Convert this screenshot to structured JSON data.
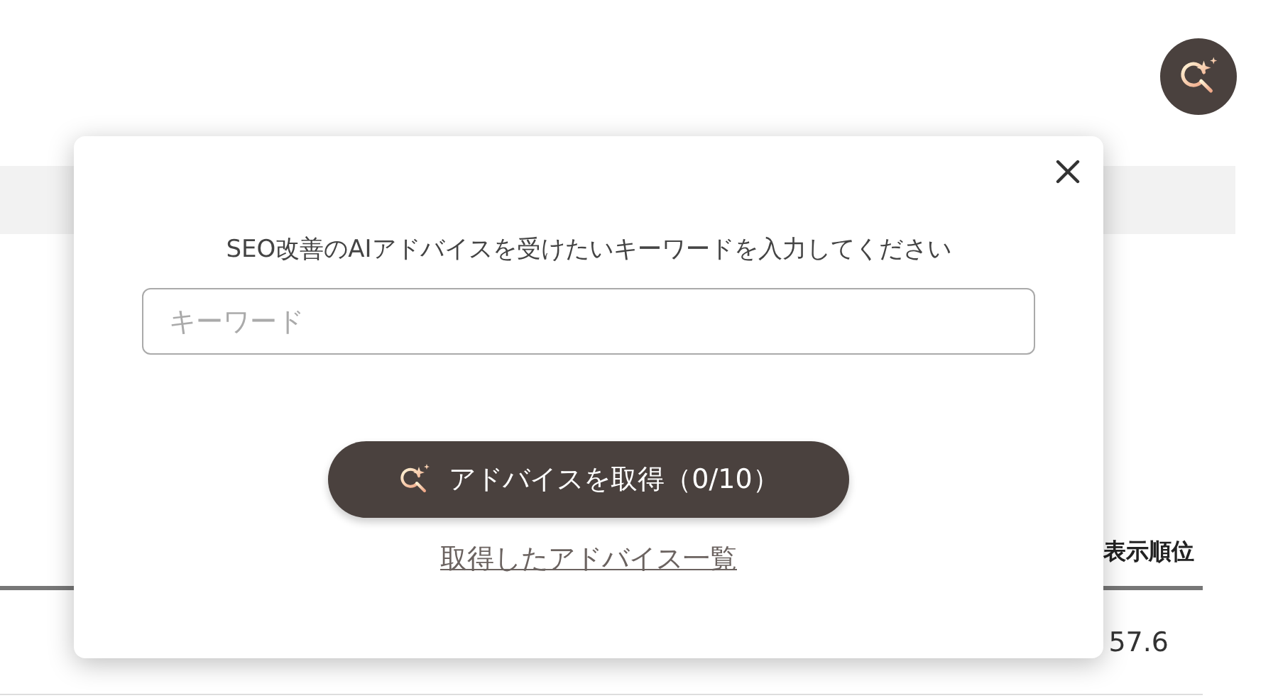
{
  "table": {
    "columns": [
      "表示順位"
    ],
    "rows": [
      [
        "57.6"
      ]
    ]
  },
  "dialog": {
    "prompt": "SEO改善のAIアドバイスを受けたいキーワードを入力してください",
    "keyword_field": {
      "placeholder": "キーワード"
    },
    "submit_button": "アドバイスを取得（0/10）",
    "history_link": "取得したアドバイス一覧"
  }
}
